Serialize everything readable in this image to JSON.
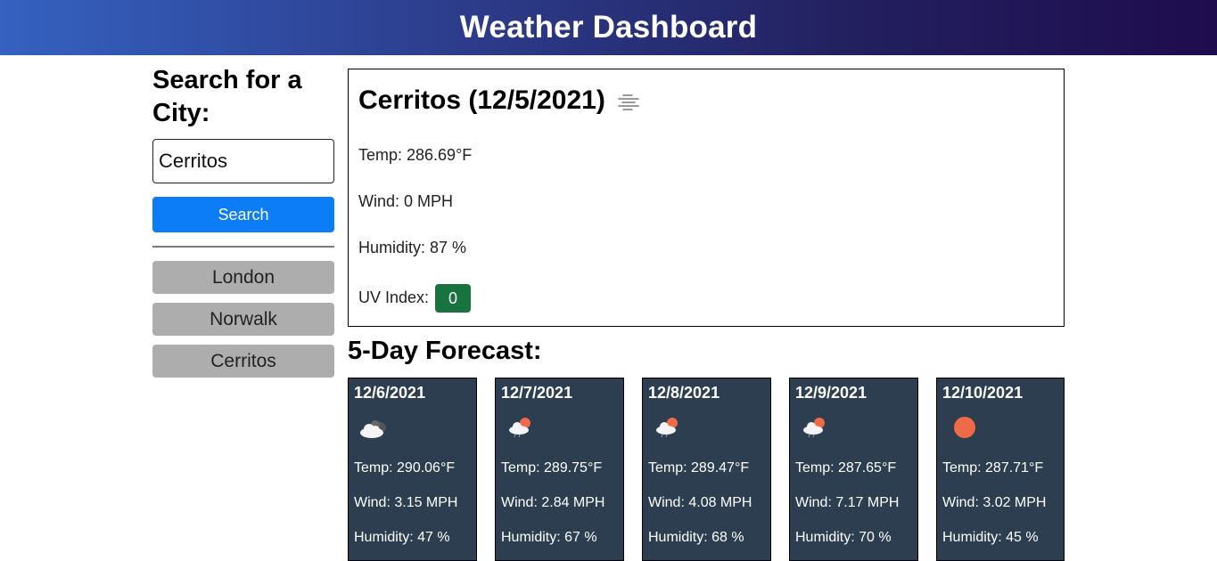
{
  "header": {
    "title": "Weather Dashboard"
  },
  "search": {
    "title": "Search for a City:",
    "input_value": "Cerritos",
    "button_label": "Search"
  },
  "history": [
    {
      "label": "London"
    },
    {
      "label": "Norwalk"
    },
    {
      "label": "Cerritos"
    }
  ],
  "current": {
    "title": "Cerritos (12/5/2021)",
    "icon": "mist-icon",
    "temp": "Temp: 286.69°F",
    "wind": "Wind: 0 MPH",
    "humidity": "Humidity: 87 %",
    "uv_label": "UV Index:",
    "uv_value": "0",
    "uv_color": "#18733e"
  },
  "forecast_title": "5-Day Forecast:",
  "forecast": [
    {
      "date": "12/6/2021",
      "icon": "broken-clouds-icon",
      "temp": "Temp: 290.06°F",
      "wind": "Wind: 3.15 MPH",
      "humidity": "Humidity: 47 %"
    },
    {
      "date": "12/7/2021",
      "icon": "rain-sun-icon",
      "temp": "Temp: 289.75°F",
      "wind": "Wind: 2.84 MPH",
      "humidity": "Humidity: 67 %"
    },
    {
      "date": "12/8/2021",
      "icon": "rain-sun-icon",
      "temp": "Temp: 289.47°F",
      "wind": "Wind: 4.08 MPH",
      "humidity": "Humidity: 68 %"
    },
    {
      "date": "12/9/2021",
      "icon": "rain-sun-icon",
      "temp": "Temp: 287.65°F",
      "wind": "Wind: 7.17 MPH",
      "humidity": "Humidity: 70 %"
    },
    {
      "date": "12/10/2021",
      "icon": "clear-sun-icon",
      "temp": "Temp: 287.71°F",
      "wind": "Wind: 3.02 MPH",
      "humidity": "Humidity: 45 %"
    }
  ],
  "colors": {
    "search_button": "#0d7cf7",
    "history_button": "#adadad",
    "forecast_card": "#2c3e50",
    "sun": "#ef6b48"
  }
}
